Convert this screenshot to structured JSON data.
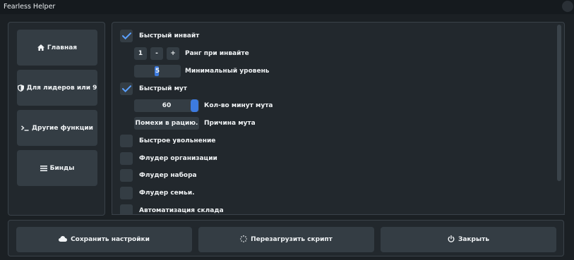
{
  "window": {
    "title": "Fearless Helper"
  },
  "sidebar": {
    "items": [
      {
        "icon": "home-icon",
        "label": "Главная"
      },
      {
        "icon": "shield-icon",
        "label": "Для лидеров или 9"
      },
      {
        "icon": "terminal-icon",
        "label": "Другие функции"
      },
      {
        "icon": "list-icon",
        "label": "Бинды"
      }
    ]
  },
  "settings": {
    "fast_invite": {
      "label": "Быстрый инвайт",
      "checked": true
    },
    "rank": {
      "value": "1",
      "minus": "-",
      "plus": "+",
      "label": "Ранг при инвайте"
    },
    "min_level": {
      "value": "5",
      "label": "Минимальный уровень"
    },
    "fast_mute": {
      "label": "Быстрый мут",
      "checked": true
    },
    "mute_minutes": {
      "value": "60",
      "label": "Кол-во минут мута"
    },
    "mute_reason": {
      "value": "Помехи в рацию.",
      "label": "Причина мута"
    },
    "fast_dismiss": {
      "label": "Быстрое увольнение",
      "checked": false
    },
    "flood_org": {
      "label": "Флудер организации",
      "checked": false
    },
    "flood_recruit": {
      "label": "Флудер набора",
      "checked": false
    },
    "flood_family": {
      "label": "Флудер семьи.",
      "checked": false
    },
    "warehouse": {
      "label": "Автоматизация склада",
      "checked": false
    }
  },
  "footer": {
    "save": {
      "icon": "cloud-icon",
      "label": "Сохранить настройки"
    },
    "reload": {
      "icon": "spinner-icon",
      "label": "Перезагрузить скрипт"
    },
    "close": {
      "icon": "power-icon",
      "label": "Закрыть"
    }
  },
  "colors": {
    "accent": "#3d7be0",
    "checkmark": "#5aa0ff",
    "panel": "#22282d",
    "button": "#343d44"
  }
}
